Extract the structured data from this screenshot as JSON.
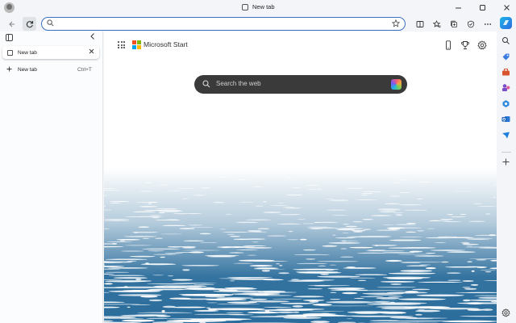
{
  "window": {
    "title": "New tab",
    "controls": [
      "minimize",
      "maximize",
      "close"
    ]
  },
  "toolbar": {
    "back_icon": "back-arrow-icon",
    "refresh_icon": "refresh-icon",
    "address": {
      "value": "",
      "placeholder": ""
    },
    "right_icons": [
      "split-screen-icon",
      "favorites-icon",
      "collections-icon",
      "browser-essentials-icon",
      "more-icon"
    ]
  },
  "vertical_tabs": {
    "tabs": [
      {
        "label": "New tab"
      }
    ],
    "new_tab_label": "New tab",
    "new_tab_shortcut": "Ctrl+T"
  },
  "page": {
    "brand": "Microsoft Start",
    "search_placeholder": "Search the web",
    "icons": [
      "apps-grid-icon",
      "mobile-icon",
      "rewards-trophy-icon",
      "settings-gear-icon",
      "copilot-icon"
    ]
  },
  "sidebar": {
    "items": [
      "copilot-icon",
      "search-icon",
      "shopping-tag-icon",
      "toolbox-icon",
      "games-icon",
      "microsoft-365-icon",
      "outlook-icon",
      "drop-icon",
      "add-icon",
      "settings-icon"
    ]
  },
  "colors": {
    "accent": "#3b6fc4",
    "search_bg": "#3a3a3a",
    "sea_blue": "#2a6c9b"
  }
}
